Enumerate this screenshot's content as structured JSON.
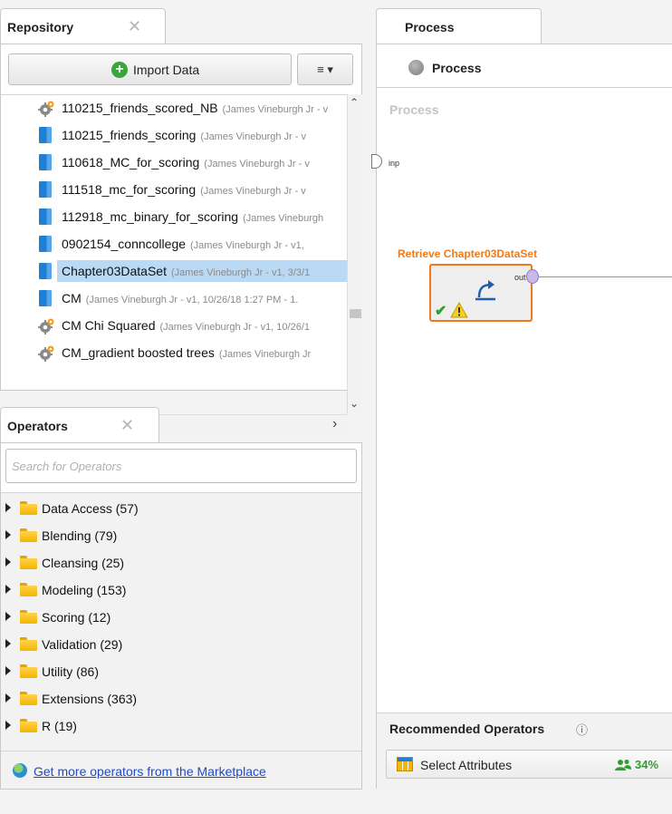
{
  "repository": {
    "tab_label": "Repository",
    "close_glyph": "✕",
    "import_label": "Import Data",
    "menu_label": "≡ ▾",
    "items": [
      {
        "type": "gear",
        "name": "110215_friends_scored_NB",
        "meta": "(James Vineburgh Jr - v"
      },
      {
        "type": "data",
        "name": "110215_friends_scoring",
        "meta": "(James Vineburgh Jr - v"
      },
      {
        "type": "data",
        "name": "110618_MC_for_scoring",
        "meta": "(James Vineburgh Jr - v"
      },
      {
        "type": "data",
        "name": "111518_mc_for_scoring",
        "meta": "(James Vineburgh Jr - v"
      },
      {
        "type": "data",
        "name": "112918_mc_binary_for_scoring",
        "meta": "(James Vineburgh"
      },
      {
        "type": "data",
        "name": "0902154_conncollege",
        "meta": "(James Vineburgh Jr - v1,"
      },
      {
        "type": "data",
        "name": "Chapter03DataSet",
        "meta": "(James Vineburgh Jr - v1, 3/3/1"
      },
      {
        "type": "data",
        "name": "CM",
        "meta": "(James Vineburgh Jr - v1, 10/26/18 1:27 PM - 1."
      },
      {
        "type": "gear",
        "name": "CM Chi Squared",
        "meta": "(James Vineburgh Jr - v1, 10/26/1"
      },
      {
        "type": "gear",
        "name": "CM_gradient boosted trees",
        "meta": "(James Vineburgh Jr"
      }
    ]
  },
  "operators": {
    "tab_label": "Operators",
    "close_glyph": "✕",
    "search_placeholder": "Search for Operators",
    "categories": [
      {
        "label": "Data Access (57)"
      },
      {
        "label": "Blending (79)"
      },
      {
        "label": "Cleansing (25)"
      },
      {
        "label": "Modeling (153)"
      },
      {
        "label": "Scoring (12)"
      },
      {
        "label": "Validation (29)"
      },
      {
        "label": "Utility (86)"
      },
      {
        "label": "Extensions (363)"
      },
      {
        "label": "R (19)"
      }
    ],
    "marketplace_link": "Get more operators from the Marketplace"
  },
  "process": {
    "tab_label": "Process",
    "header_label": "Process",
    "canvas_title": "Process",
    "inp_label": "inp",
    "operator": {
      "title": "Retrieve Chapter03DataSet",
      "out_label": "out"
    }
  },
  "recommended": {
    "title": "Recommended Operators",
    "info_glyph": "ⓘ",
    "item_label": "Select Attributes",
    "item_percent": "34%"
  },
  "colors": {
    "accent_orange": "#f07a1a",
    "selection_blue": "#b9d9f5",
    "link_blue": "#1a4ad6",
    "success_green": "#2e9e2e"
  }
}
